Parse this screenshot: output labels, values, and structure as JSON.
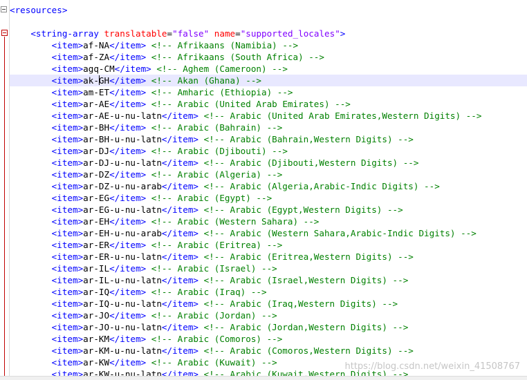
{
  "editor": {
    "resources_open": "<resources>",
    "array": {
      "open_tag": "<string-array",
      "attr1_name": "translatable",
      "attr1_value": "\"false\"",
      "attr2_name": "name",
      "attr2_value": "\"supported_locales\"",
      "close_bracket": ">"
    },
    "item_open": "<item>",
    "item_close": "</item>",
    "items": [
      {
        "code": "af-NA",
        "comment": "<!-- Afrikaans (Namibia) -->"
      },
      {
        "code": "af-ZA",
        "comment": "<!-- Afrikaans (South Africa) -->"
      },
      {
        "code": "agq-CM",
        "comment": "<!-- Aghem (Cameroon) -->"
      },
      {
        "code": "ak-GH",
        "comment": "<!-- Akan (Ghana) -->"
      },
      {
        "code": "am-ET",
        "comment": "<!-- Amharic (Ethiopia) -->"
      },
      {
        "code": "ar-AE",
        "comment": "<!-- Arabic (United Arab Emirates) -->"
      },
      {
        "code": "ar-AE-u-nu-latn",
        "comment": "<!-- Arabic (United Arab Emirates,Western Digits) -->"
      },
      {
        "code": "ar-BH",
        "comment": "<!-- Arabic (Bahrain) -->"
      },
      {
        "code": "ar-BH-u-nu-latn",
        "comment": "<!-- Arabic (Bahrain,Western Digits) -->"
      },
      {
        "code": "ar-DJ",
        "comment": "<!-- Arabic (Djibouti) -->"
      },
      {
        "code": "ar-DJ-u-nu-latn",
        "comment": "<!-- Arabic (Djibouti,Western Digits) -->"
      },
      {
        "code": "ar-DZ",
        "comment": "<!-- Arabic (Algeria) -->"
      },
      {
        "code": "ar-DZ-u-nu-arab",
        "comment": "<!-- Arabic (Algeria,Arabic-Indic Digits) -->"
      },
      {
        "code": "ar-EG",
        "comment": "<!-- Arabic (Egypt) -->"
      },
      {
        "code": "ar-EG-u-nu-latn",
        "comment": "<!-- Arabic (Egypt,Western Digits) -->"
      },
      {
        "code": "ar-EH",
        "comment": "<!-- Arabic (Western Sahara) -->"
      },
      {
        "code": "ar-EH-u-nu-arab",
        "comment": "<!-- Arabic (Western Sahara,Arabic-Indic Digits) -->"
      },
      {
        "code": "ar-ER",
        "comment": "<!-- Arabic (Eritrea) -->"
      },
      {
        "code": "ar-ER-u-nu-latn",
        "comment": "<!-- Arabic (Eritrea,Western Digits) -->"
      },
      {
        "code": "ar-IL",
        "comment": "<!-- Arabic (Israel) -->"
      },
      {
        "code": "ar-IL-u-nu-latn",
        "comment": "<!-- Arabic (Israel,Western Digits) -->"
      },
      {
        "code": "ar-IQ",
        "comment": "<!-- Arabic (Iraq) -->"
      },
      {
        "code": "ar-IQ-u-nu-latn",
        "comment": "<!-- Arabic (Iraq,Western Digits) -->"
      },
      {
        "code": "ar-JO",
        "comment": "<!-- Arabic (Jordan) -->"
      },
      {
        "code": "ar-JO-u-nu-latn",
        "comment": "<!-- Arabic (Jordan,Western Digits) -->"
      },
      {
        "code": "ar-KM",
        "comment": "<!-- Arabic (Comoros) -->"
      },
      {
        "code": "ar-KM-u-nu-latn",
        "comment": "<!-- Arabic (Comoros,Western Digits) -->"
      },
      {
        "code": "ar-KW",
        "comment": "<!-- Arabic (Kuwait) -->"
      },
      {
        "code": "ar-KW-u-nu-latn",
        "comment": "<!-- Arabic (Kuwait,Western Digits) -->"
      }
    ],
    "current_line_code": "ak-GH"
  },
  "watermark": "https://blog.csdn.net/weixin_41508767",
  "colors": {
    "tag": "#0000ff",
    "attribute": "#ff0000",
    "attribute_value": "#8000ff",
    "comment": "#008000",
    "current_line": "#e8e8ff",
    "fold_marker": "#c00000"
  }
}
